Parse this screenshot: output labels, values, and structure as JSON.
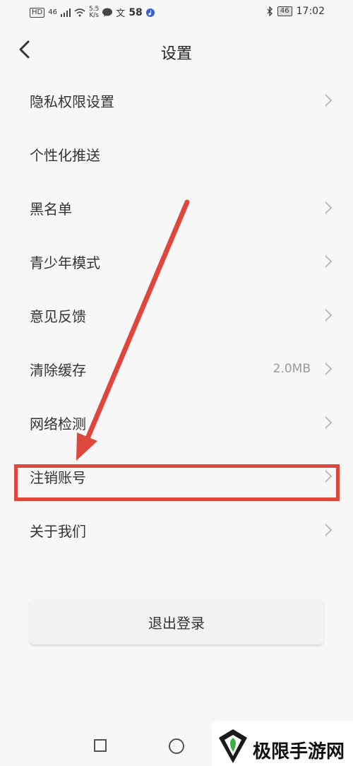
{
  "status_bar": {
    "hd": "HD",
    "net": "46",
    "speed_top": "5.5",
    "speed_bottom": "K/s",
    "notif_count": "58",
    "battery": "46",
    "time": "17:02"
  },
  "header": {
    "title": "设置",
    "back_icon": "chevron-left-icon"
  },
  "menu": {
    "items": [
      {
        "label": "隐私权限设置",
        "value": "",
        "has_chevron": true
      },
      {
        "label": "个性化推送",
        "value": "",
        "has_chevron": false
      },
      {
        "label": "黑名单",
        "value": "",
        "has_chevron": true
      },
      {
        "label": "青少年模式",
        "value": "",
        "has_chevron": true
      },
      {
        "label": "意见反馈",
        "value": "",
        "has_chevron": true
      },
      {
        "label": "清除缓存",
        "value": "2.0MB",
        "has_chevron": true
      },
      {
        "label": "网络检测",
        "value": "",
        "has_chevron": true
      },
      {
        "label": "注销账号",
        "value": "",
        "has_chevron": true
      },
      {
        "label": "关于我们",
        "value": "",
        "has_chevron": true
      }
    ]
  },
  "logout": {
    "label": "退出登录"
  },
  "annotation": {
    "highlight_color": "#e0473c"
  },
  "watermark": {
    "text": "极限手游网"
  }
}
